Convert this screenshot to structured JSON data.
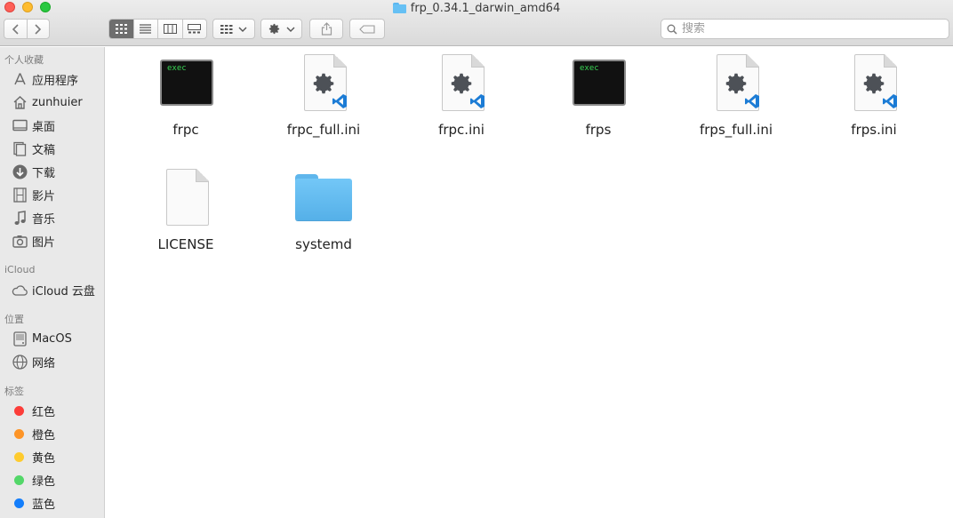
{
  "window": {
    "title": "frp_0.34.1_darwin_amd64"
  },
  "toolbar": {
    "back_icon": "chevron-left-icon",
    "forward_icon": "chevron-right-icon",
    "view_modes": [
      "icon",
      "list",
      "column",
      "gallery"
    ],
    "active_view": "icon",
    "search_placeholder": "搜索"
  },
  "sidebar": {
    "favorites_header": "个人收藏",
    "favorites": [
      {
        "label": "应用程序",
        "icon": "applications-icon"
      },
      {
        "label": "zunhuier",
        "icon": "home-icon"
      },
      {
        "label": "桌面",
        "icon": "desktop-icon"
      },
      {
        "label": "文稿",
        "icon": "documents-icon"
      },
      {
        "label": "下载",
        "icon": "download-icon"
      },
      {
        "label": "影片",
        "icon": "movies-icon"
      },
      {
        "label": "音乐",
        "icon": "music-icon"
      },
      {
        "label": "图片",
        "icon": "pictures-icon"
      }
    ],
    "icloud_header": "iCloud",
    "icloud": [
      {
        "label": "iCloud 云盘",
        "icon": "cloud-icon"
      }
    ],
    "locations_header": "位置",
    "locations": [
      {
        "label": "MacOS",
        "icon": "disk-icon"
      },
      {
        "label": "网络",
        "icon": "network-icon"
      }
    ],
    "tags_header": "标签",
    "tags": [
      {
        "label": "红色",
        "color": "#fc3d39"
      },
      {
        "label": "橙色",
        "color": "#fd9426"
      },
      {
        "label": "黄色",
        "color": "#fecb2e"
      },
      {
        "label": "绿色",
        "color": "#53d769"
      },
      {
        "label": "蓝色",
        "color": "#147efb"
      }
    ]
  },
  "files": [
    {
      "name": "frpc",
      "type": "exec",
      "badge": "exec"
    },
    {
      "name": "frpc_full.ini",
      "type": "ini"
    },
    {
      "name": "frpc.ini",
      "type": "ini"
    },
    {
      "name": "frps",
      "type": "exec",
      "badge": "exec"
    },
    {
      "name": "frps_full.ini",
      "type": "ini"
    },
    {
      "name": "frps.ini",
      "type": "ini"
    },
    {
      "name": "LICENSE",
      "type": "document"
    },
    {
      "name": "systemd",
      "type": "folder"
    }
  ],
  "colors": {
    "exec_text": "#39d353",
    "vscode_blue": "#1c7cd5",
    "folder_blue": "#66c0f4"
  }
}
